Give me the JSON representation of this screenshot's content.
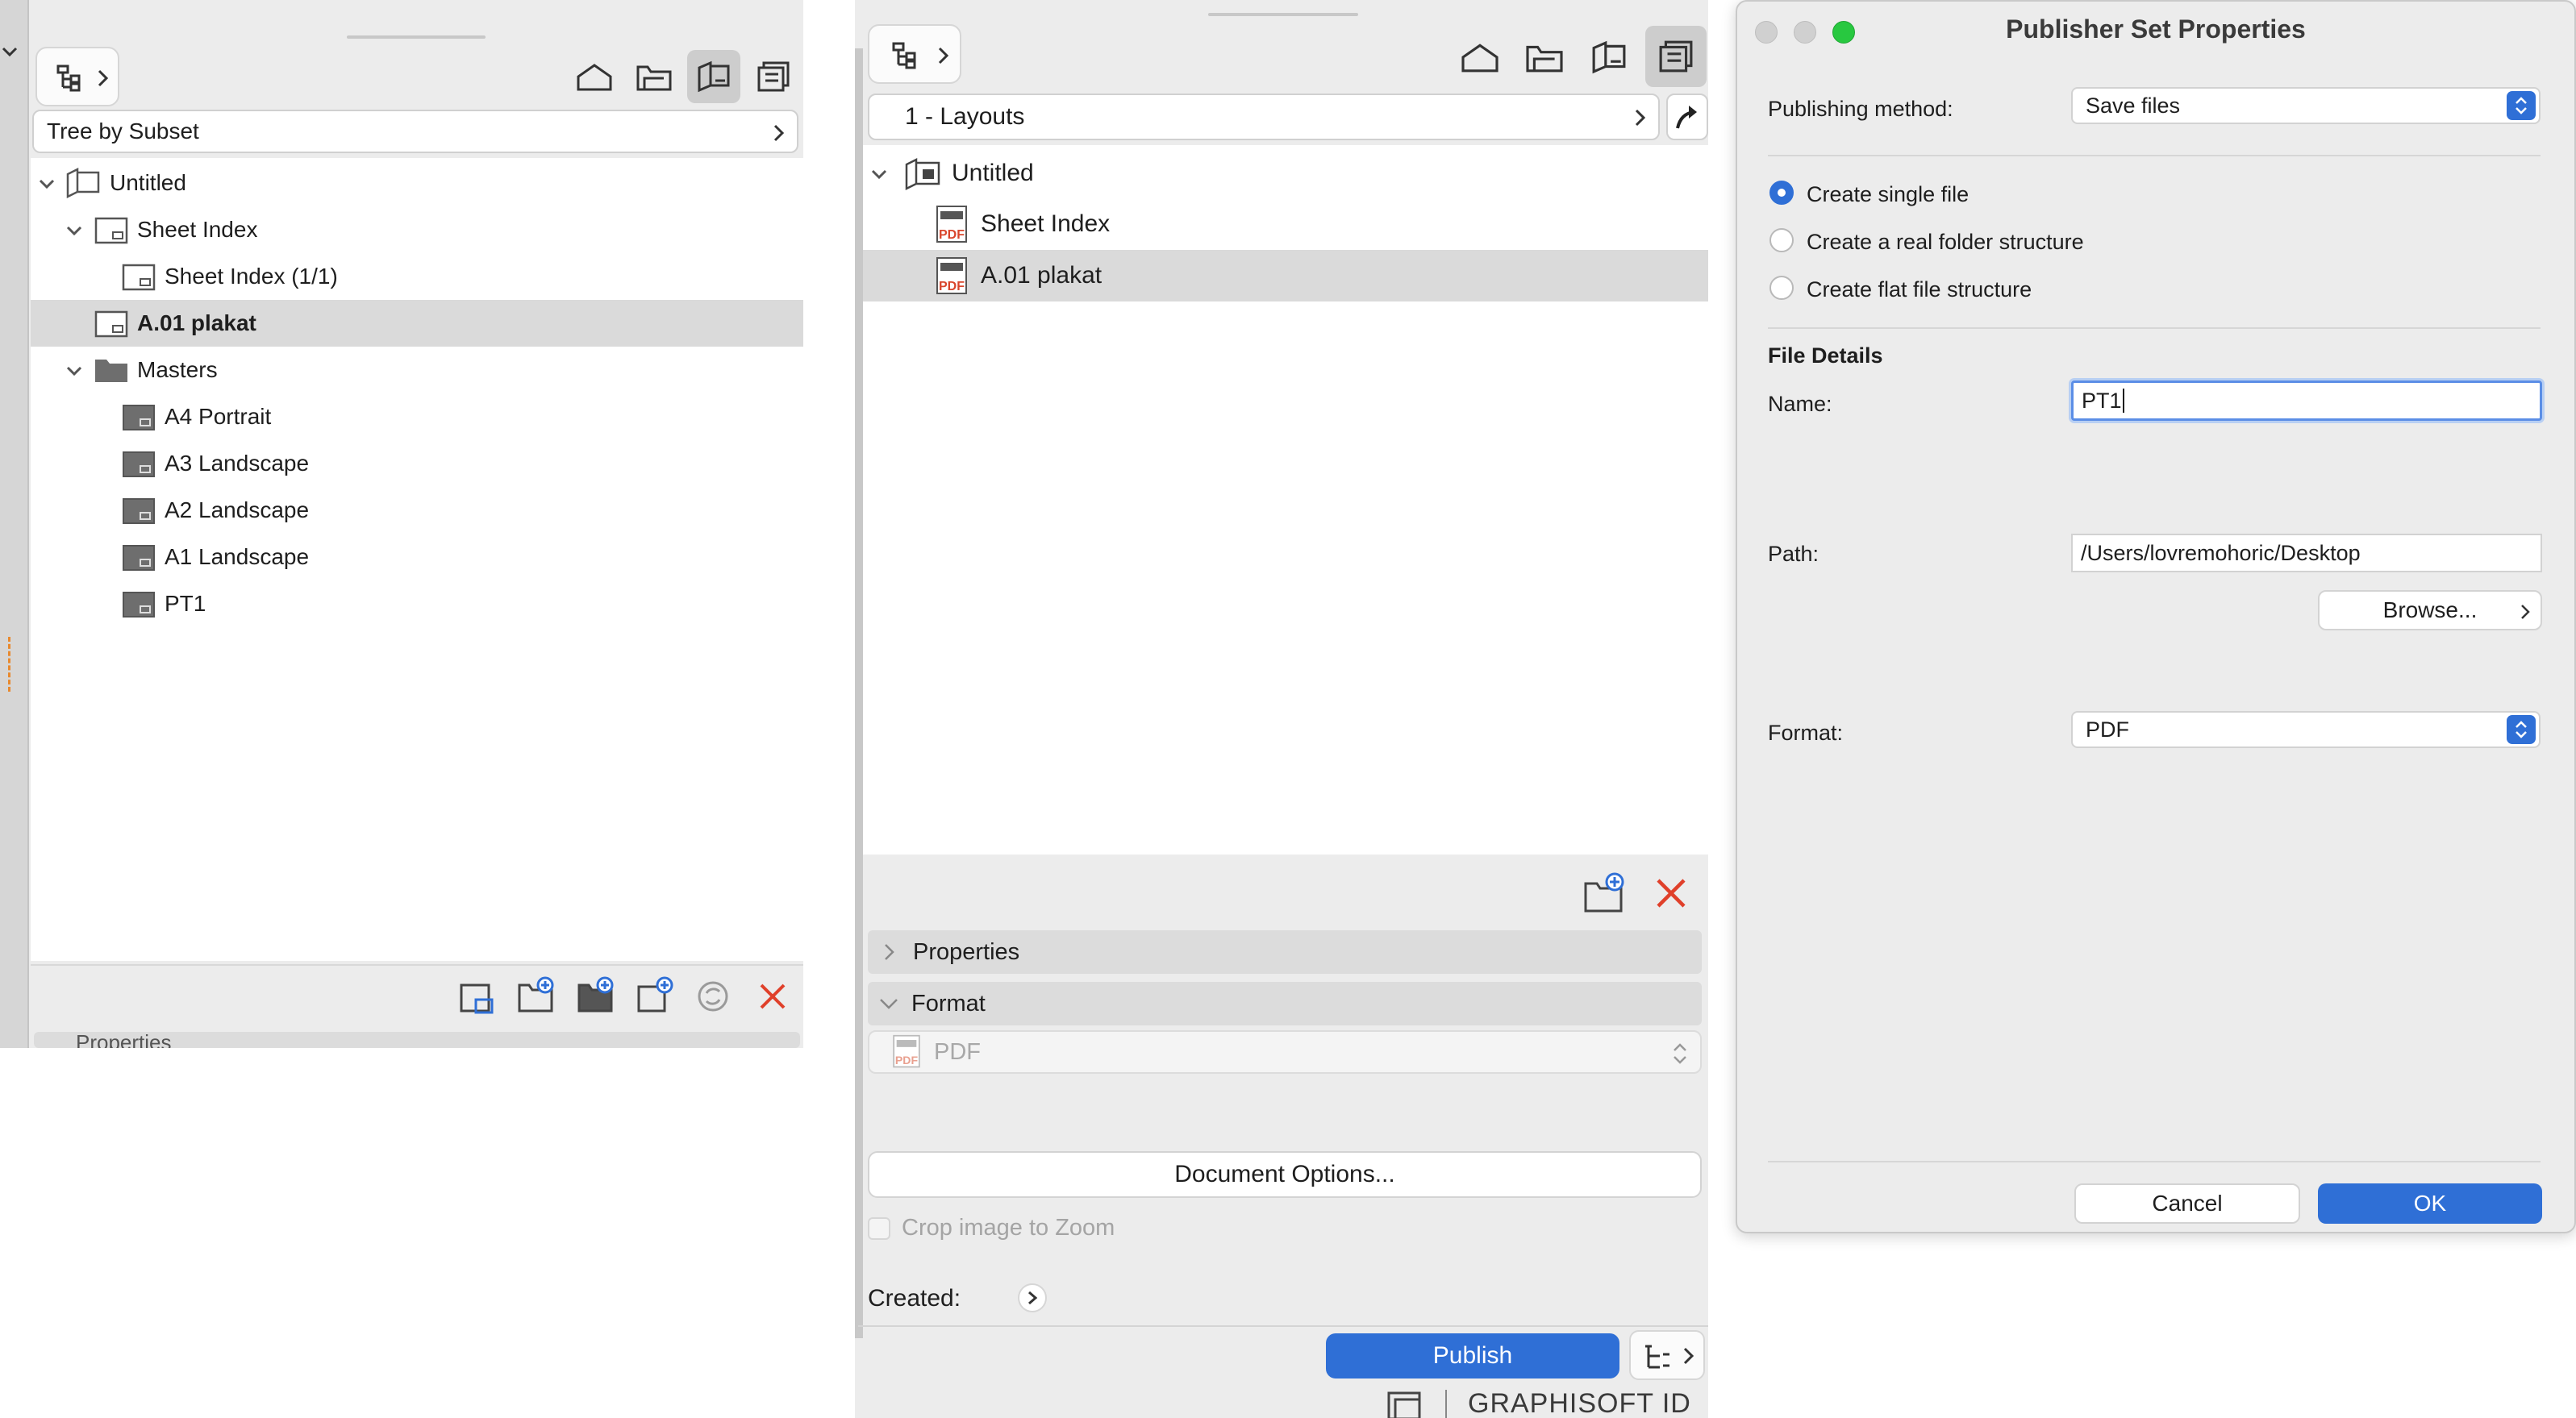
{
  "left_panel": {
    "subset_combo": "Tree by Subset",
    "tree": [
      {
        "label": "Untitled",
        "bold": false
      },
      {
        "label": "Sheet Index",
        "bold": false
      },
      {
        "label": "Sheet Index (1/1)",
        "bold": false
      },
      {
        "label": "A.01 plakat",
        "bold": true
      },
      {
        "label": "Masters",
        "bold": false
      },
      {
        "label": "A4 Portrait",
        "bold": false
      },
      {
        "label": "A3 Landscape",
        "bold": false
      },
      {
        "label": "A2 Landscape",
        "bold": false
      },
      {
        "label": "A1 Landscape",
        "bold": false
      },
      {
        "label": "PT1",
        "bold": false
      }
    ],
    "properties_label": "Properties"
  },
  "middle_panel": {
    "set_combo": "1 - Layouts",
    "tree": [
      {
        "label": "Untitled"
      },
      {
        "label": "Sheet Index"
      },
      {
        "label": "A.01 plakat"
      }
    ],
    "properties_label": "Properties",
    "format_label": "Format",
    "format_value": "PDF",
    "document_options_label": "Document Options...",
    "crop_label": "Crop image to Zoom",
    "created_label": "Created:",
    "publish_label": "Publish",
    "brand": "GRAPHISOFT ID"
  },
  "dialog": {
    "title": "Publisher Set Properties",
    "publishing_method_label": "Publishing method:",
    "publishing_method_value": "Save files",
    "radios": [
      {
        "label": "Create single file",
        "selected": true
      },
      {
        "label": "Create a real folder structure",
        "selected": false
      },
      {
        "label": "Create flat file structure",
        "selected": false
      }
    ],
    "file_details_label": "File Details",
    "name_label": "Name:",
    "name_value": "PT1",
    "path_label": "Path:",
    "path_value": "/Users/lovremohoric/Desktop",
    "browse_label": "Browse...",
    "format_label": "Format:",
    "format_value": "PDF",
    "cancel_label": "Cancel",
    "ok_label": "OK"
  },
  "colors": {
    "accent": "#2f6fd6",
    "delete_red": "#e0402a",
    "pdf_red": "#d9452c",
    "close_light": "#ff5f57",
    "green_light": "#28c840"
  }
}
